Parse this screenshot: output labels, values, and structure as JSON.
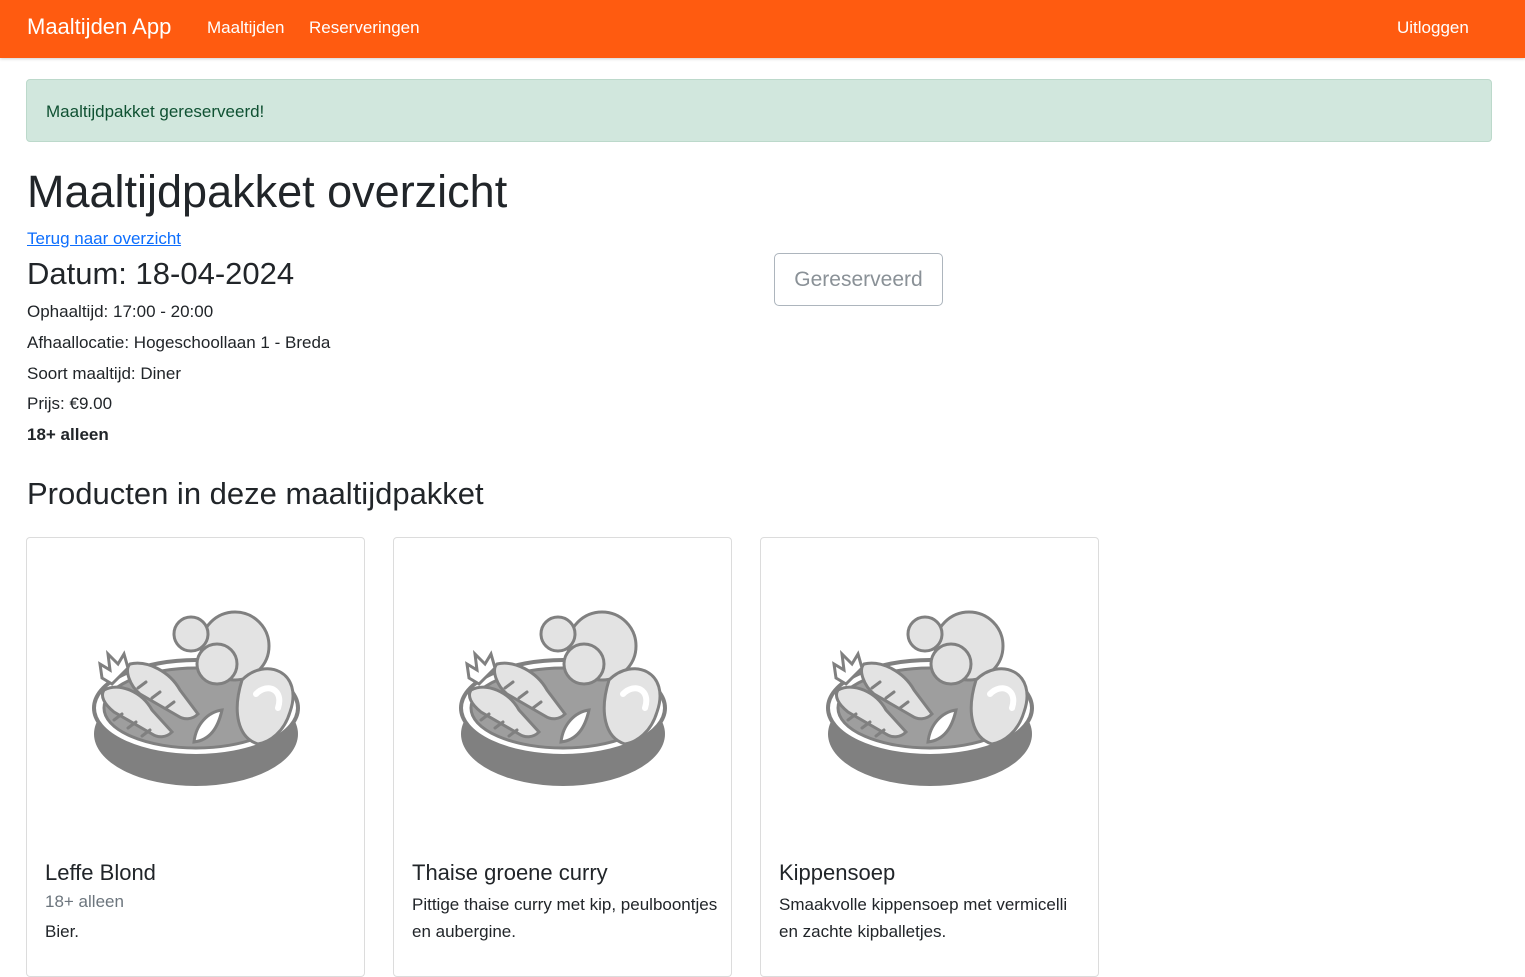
{
  "navbar": {
    "brand": "Maaltijden App",
    "links": [
      "Maaltijden",
      "Reserveringen"
    ],
    "logout": "Uitloggen",
    "color": "#ff5b10"
  },
  "alert": {
    "text": "Maaltijdpakket gereserveerd!"
  },
  "page": {
    "title": "Maaltijdpakket overzicht",
    "back_link": "Terug naar overzicht",
    "date": "Datum: 18-04-2024",
    "pickup_time": "Ophaaltijd: 17:00 - 20:00",
    "location": "Afhaallocatie: Hogeschoollaan 1 - Breda",
    "meal_type": "Soort maaltijd: Diner",
    "price": "Prijs: €9.00",
    "age_restriction": "18+ alleen",
    "reserve_button": "Gereserveerd"
  },
  "products": {
    "heading": "Producten in deze maaltijdpakket",
    "image_icon": "food-bowl-icon",
    "items": [
      {
        "name": "Leffe Blond",
        "subtitle": "18+ alleen",
        "description": "Bier."
      },
      {
        "name": "Thaise groene curry",
        "description": "Pittige thaise curry met kip, peulboontjes en aubergine."
      },
      {
        "name": "Kippensoep",
        "description": "Smaakvolle kippensoep met vermicelli en zachte kipballetjes."
      }
    ]
  }
}
